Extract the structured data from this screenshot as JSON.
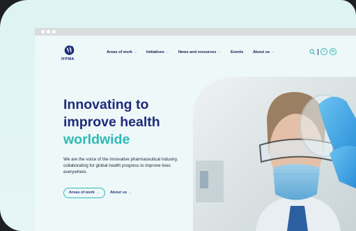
{
  "site": {
    "logo_text": "IFPMA"
  },
  "nav": {
    "items": [
      {
        "label": "Areas of work",
        "dropdown": true
      },
      {
        "label": "Initiatives",
        "dropdown": true
      },
      {
        "label": "News and resources",
        "dropdown": true
      },
      {
        "label": "Events",
        "dropdown": false
      },
      {
        "label": "About us",
        "dropdown": true
      }
    ],
    "icons": [
      "search-icon",
      "twitter-icon",
      "linkedin-icon"
    ]
  },
  "hero": {
    "title_line1": "Innovating to",
    "title_line2": "improve health",
    "title_line3": "worldwide",
    "subtitle": "We are the voice of the innovative pharmaceutical industry, collaborating for global health progress to improve lives everywhere.",
    "primary_cta": "Areas of work",
    "secondary_cta": "About us",
    "arrow": "→"
  },
  "colors": {
    "brand_navy": "#1f2a7a",
    "brand_teal": "#2fb8b8",
    "page_bg": "#eef8f9"
  }
}
